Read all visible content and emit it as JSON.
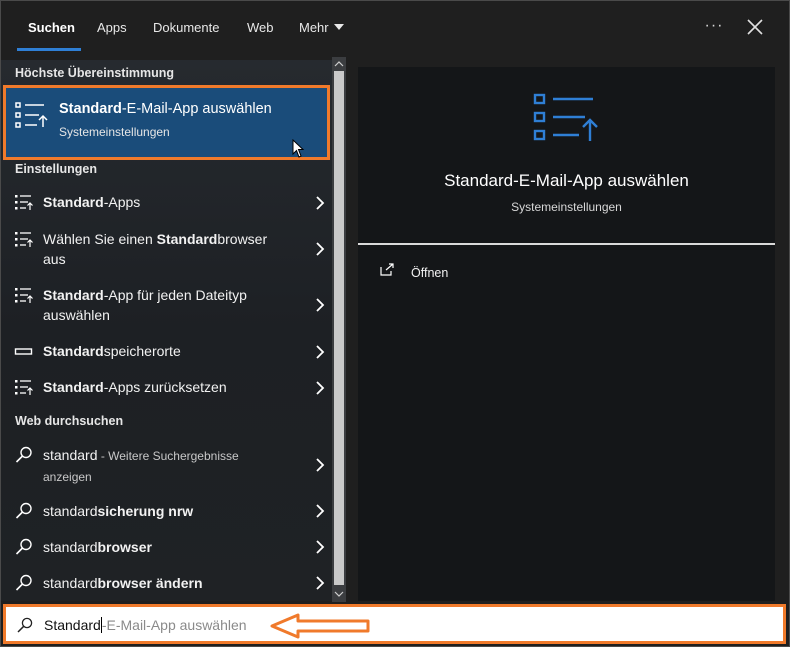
{
  "tabs": {
    "suchen": "Suchen",
    "apps": "Apps",
    "dokumente": "Dokumente",
    "web": "Web",
    "mehr": "Mehr"
  },
  "icons": {
    "more_options": "more-options-icon",
    "close": "close-icon"
  },
  "colors": {
    "accent": "#2f7fd5",
    "selection": "#1a4c7a",
    "annotation": "#f07a2b"
  },
  "best_match": {
    "header": "Höchste Übereinstimmung",
    "title_bold": "Standard",
    "title_rest": "-E-Mail-App auswählen",
    "subtitle": "Systemeinstellungen"
  },
  "settings": {
    "header": "Einstellungen",
    "items": [
      {
        "pre": "",
        "bold": "Standard",
        "post": "-Apps"
      },
      {
        "pre": "Wählen Sie einen ",
        "bold": "Standard",
        "post": "browser",
        "line2": "aus"
      },
      {
        "pre": "",
        "bold": "Standard",
        "post": "-App für jeden Dateityp",
        "line2": "auswählen"
      },
      {
        "pre": "",
        "bold": "Standard",
        "post": "speicherorte"
      },
      {
        "pre": "",
        "bold": "Standard",
        "post": "-Apps zurücksetzen"
      }
    ]
  },
  "web": {
    "header": "Web durchsuchen",
    "items": [
      {
        "pre": "standard",
        "bold": "",
        "dim": " - Weitere Suchergebnisse",
        "line2": "anzeigen"
      },
      {
        "pre": "standard",
        "bold": "sicherung nrw"
      },
      {
        "pre": "standard",
        "bold": "browser"
      },
      {
        "pre": "standard",
        "bold": "browser ändern"
      }
    ]
  },
  "preview": {
    "title": "Standard-E-Mail-App auswählen",
    "subtitle": "Systemeinstellungen",
    "open_label": "Öffnen"
  },
  "search": {
    "typed": "Standard",
    "suggestion": "-E-Mail-App auswählen"
  }
}
